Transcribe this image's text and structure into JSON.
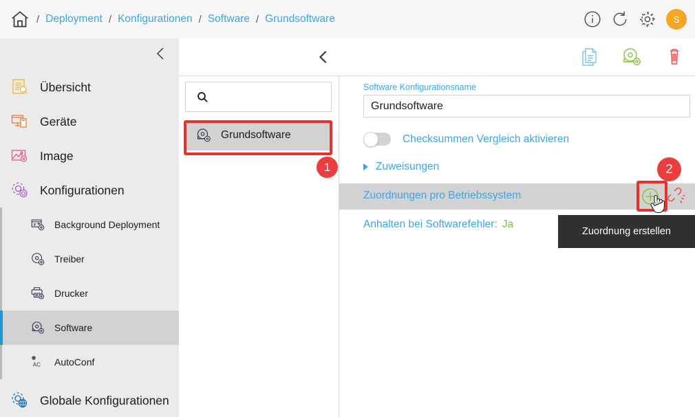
{
  "header": {
    "home_icon": "home-icon",
    "breadcrumb": [
      {
        "label": "Deployment"
      },
      {
        "label": "Konfigurationen"
      },
      {
        "label": "Software"
      },
      {
        "label": "Grundsoftware"
      }
    ],
    "separator": "/",
    "actions": [
      {
        "name": "info-icon",
        "title": "Info"
      },
      {
        "name": "refresh-icon",
        "title": "Aktualisieren"
      },
      {
        "name": "gear-icon",
        "title": "Einstellungen"
      }
    ],
    "avatar_initial": "S",
    "avatar_color": "#f5a623"
  },
  "sidebar": {
    "collapse_icon": "chevron-left-icon",
    "items": [
      {
        "label": "Übersicht",
        "icon": "overview-icon",
        "color": "#f0b429",
        "active": false
      },
      {
        "label": "Geräte",
        "icon": "devices-icon",
        "color": "#ef7d3a",
        "active": false
      },
      {
        "label": "Image",
        "icon": "image-icon",
        "color": "#e8557a",
        "active": false
      },
      {
        "label": "Konfigurationen",
        "icon": "configurations-icon",
        "color": "#a65bc4",
        "active": false
      }
    ],
    "subitems": [
      {
        "label": "Background Deployment",
        "icon": "background-deployment-icon",
        "active": false
      },
      {
        "label": "Treiber",
        "icon": "driver-icon",
        "active": false
      },
      {
        "label": "Drucker",
        "icon": "printer-icon",
        "active": false
      },
      {
        "label": "Software",
        "icon": "software-icon",
        "active": true
      },
      {
        "label": "AutoConf",
        "icon": "autoconf-icon",
        "active": false
      }
    ],
    "footer_item": {
      "label": "Globale Konfigurationen",
      "icon": "global-configurations-icon",
      "color": "#1b6fb5"
    },
    "active_accent_color": "#1b9ad6"
  },
  "list_panel": {
    "collapse_icon": "chevron-left-icon",
    "search": {
      "placeholder": "",
      "value": "",
      "icon": "search-icon"
    },
    "items": [
      {
        "label": "Grundsoftware",
        "icon": "software-disc-icon",
        "selected": true
      }
    ]
  },
  "detail_panel": {
    "back_icon": "chevron-left-icon",
    "toolbar": [
      {
        "name": "copy-document-icon",
        "color": "#7fc2e8"
      },
      {
        "name": "software-disc-icon",
        "color": "#8bc53f"
      },
      {
        "name": "delete-trash-icon",
        "color": "#ef5350"
      }
    ],
    "name_field": {
      "label": "Software Konfigurationsname",
      "value": "Grundsoftware",
      "placeholder": ""
    },
    "checksum_toggle": {
      "label": "Checksummen Vergleich aktivieren",
      "enabled": false
    },
    "rows": [
      {
        "label": "Zuweisungen",
        "type": "expandable",
        "expanded": false
      },
      {
        "label": "Zuordnungen pro Betriebssystem",
        "type": "section",
        "highlighted": true,
        "actions": [
          {
            "name": "add-assignment-icon",
            "color": "#8bc53f"
          },
          {
            "name": "broken-link-icon",
            "color": "#ef5350"
          }
        ]
      },
      {
        "label": "Anhalten bei Softwarefehler:",
        "type": "value",
        "value": "Ja",
        "value_color": "#76c043"
      }
    ]
  },
  "tooltip": {
    "text": "Zuordnung erstellen"
  },
  "annotations": [
    {
      "id": "1",
      "target": "list-item-grundsoftware"
    },
    {
      "id": "2",
      "target": "add-assignment-icon"
    }
  ],
  "colors": {
    "accent_blue": "#3aa6e8",
    "annotation_red": "#e8312a",
    "highlight_gray": "#d2d2d2",
    "sidebar_bg": "#ebebeb"
  }
}
